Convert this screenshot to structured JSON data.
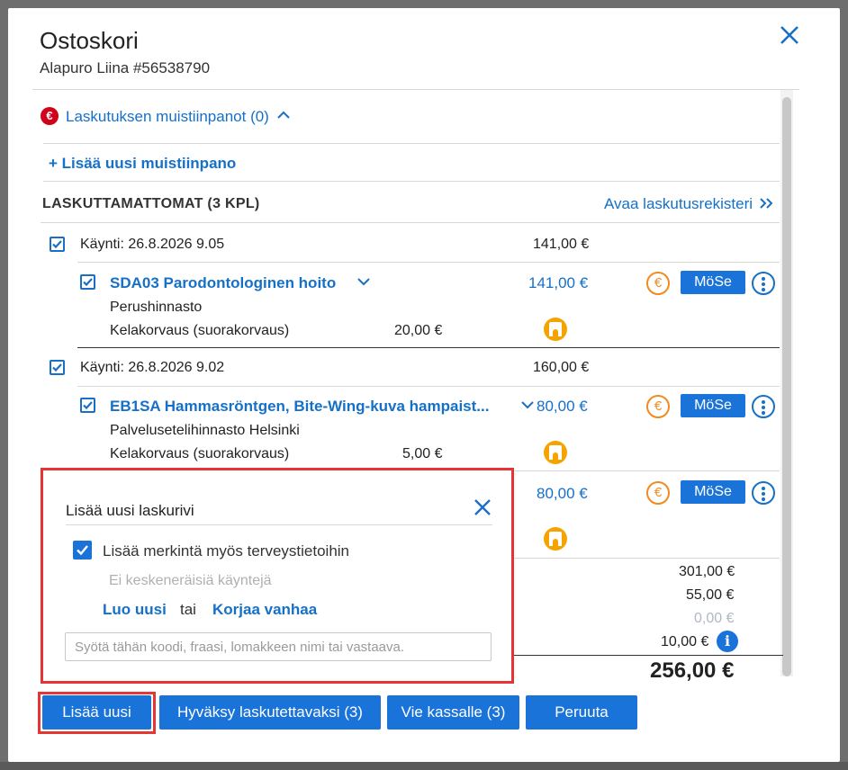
{
  "modal": {
    "title": "Ostoskori",
    "subtitle": "Alapuro Liina #56538790",
    "notes_label": "Laskutuksen muistiinpanot (0)",
    "add_note": "+ Lisää uusi muistiinpano",
    "section_title": "LASKUTTAMATTOMAT (3 KPL)",
    "open_register": "Avaa laskutusrekisteri",
    "visits": [
      {
        "label": "Käynti: 26.8.2026 9.05",
        "total": "141,00 €",
        "item": {
          "code": "SDA03 Parodontologinen hoito",
          "price": "141,00 €",
          "pricelist": "Perushinnasto",
          "kela_label": "Kelakorvaus (suorakorvaus)",
          "kela_amount": "20,00 €",
          "tax": "MöSe"
        }
      },
      {
        "label": "Käynti: 26.8.2026 9.02",
        "total": "160,00 €",
        "item": {
          "code": "EB1SA Hammasröntgen, Bite-Wing-kuva hampaist...",
          "price": "80,00 €",
          "pricelist": "Palvelusetelihinnasto Helsinki",
          "kela_label": "Kelakorvaus (suorakorvaus)",
          "kela_amount": "5,00 €",
          "tax": "MöSe"
        },
        "item2": {
          "price": "80,00 €",
          "tax": "MöSe"
        }
      }
    ],
    "totals": {
      "t1": "301,00 €",
      "t2": "55,00 €",
      "t3": "0,00 €",
      "t4": "10,00 €",
      "grand": "256,00 €"
    }
  },
  "popup": {
    "title": "Lisää uusi laskurivi",
    "checkbox_label": "Lisää merkintä myös terveystietoihin",
    "no_visits": "Ei keskeneräisiä käyntejä",
    "create_new": "Luo uusi",
    "or": "tai",
    "fix_old": "Korjaa vanhaa",
    "input_placeholder": "Syötä tähän koodi, fraasi, lomakkeen nimi tai vastaava."
  },
  "footer": {
    "add_new": "Lisää uusi",
    "approve": "Hyväksy laskutettavaksi (3)",
    "to_checkout": "Vie kassalle (3)",
    "cancel": "Peruuta"
  },
  "colors": {
    "accent": "#1a73d9",
    "highlight": "#e53535",
    "orange": "#f08c1e"
  }
}
